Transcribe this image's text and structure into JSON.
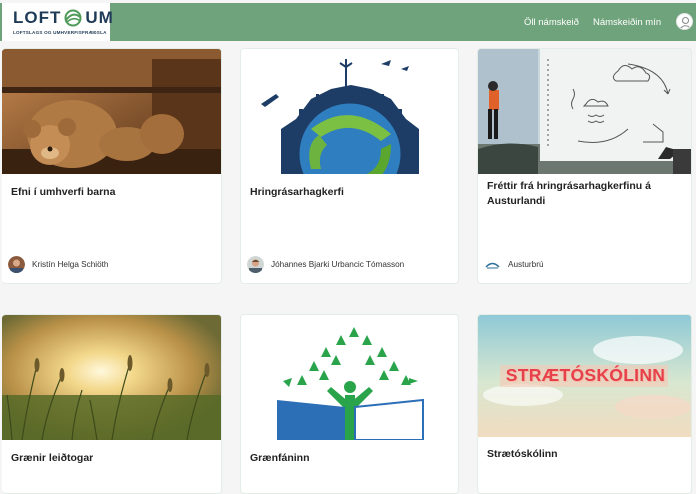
{
  "logo": {
    "text": "LOFTSLAGS OG UMHVERFISFRÆÐSLA"
  },
  "nav": {
    "all_courses": "Öll námskeið",
    "my_courses": "Námskeiðin mín"
  },
  "courses": [
    {
      "title": "Efni í umhverfi barna",
      "author": "Kristín Helga Schiöth"
    },
    {
      "title": "Hringrásarhagkerfi",
      "author": "Jóhannes Bjarki Urbancic Tómasson"
    },
    {
      "title": "Fréttir frá hringrásarhagkerfinu á Austurlandi",
      "author": "Austurbrú"
    },
    {
      "title": "Grænir leiðtogar"
    },
    {
      "title": "Grænfáninn"
    },
    {
      "title": "Strætóskólinn",
      "image_text": "STRÆTÓSKÓLINN"
    }
  ],
  "colors": {
    "header": "#6fa37b",
    "logo_navy": "#1f3b57",
    "logo_green": "#4f9a58"
  },
  "icons": {
    "user": "user-icon",
    "logo_mark": "leaf-swirl-icon"
  }
}
